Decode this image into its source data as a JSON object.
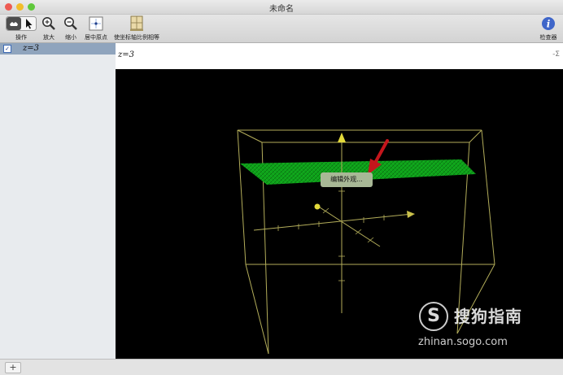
{
  "window": {
    "title": "未命名"
  },
  "toolbar": {
    "operate_label": "操作",
    "zoom_in_label": "放大",
    "zoom_out_label": "缩小",
    "center_origin_label": "居中原点",
    "equal_axes_label": "使坐标轴比例相等",
    "inspector_label": "检查器"
  },
  "sidebar": {
    "items": [
      {
        "checked": true,
        "check_glyph": "✓",
        "expression": "z=3"
      }
    ]
  },
  "input": {
    "expression": "z=3",
    "sigma_glyph": "-Σ"
  },
  "canvas": {
    "context_button_label": "编辑外观..."
  },
  "watermark": {
    "logo_glyph": "S",
    "brand": "搜狗指南",
    "url": "zhinan.sogo.com"
  },
  "bottom": {
    "add_glyph": "+"
  },
  "colors": {
    "plot_green": "#0fa21a",
    "box_yellow": "#b3ad5a",
    "arrow_red": "#c4161c",
    "sidebar_selected": "#8fa4bd"
  },
  "icons": {
    "traffic_lights": [
      "close-icon",
      "minimize-icon",
      "zoom-icon"
    ],
    "operate": [
      "hand-icon",
      "pointer-icon"
    ],
    "zoom_in": "magnifier-plus-icon",
    "zoom_out": "magnifier-minus-icon",
    "center": "crosshair-icon",
    "equal_axes": "ruler-icon",
    "inspector": "info-icon"
  }
}
